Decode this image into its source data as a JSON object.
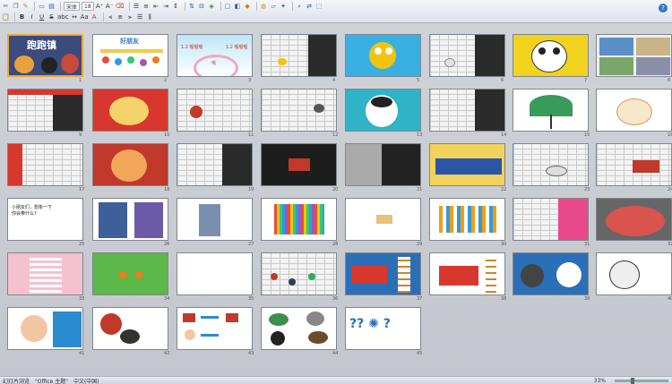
{
  "toolbar": {
    "font_name": "宋体",
    "font_size": "18",
    "bold": "B",
    "italic": "I",
    "underline": "U",
    "strike": "S",
    "shadow": "abc",
    "font_color": "A"
  },
  "slides": [
    {
      "n": "1"
    },
    {
      "n": "2"
    },
    {
      "n": "3"
    },
    {
      "n": "4"
    },
    {
      "n": "5"
    },
    {
      "n": "6"
    },
    {
      "n": "7"
    },
    {
      "n": "8"
    },
    {
      "n": "9"
    },
    {
      "n": "10"
    },
    {
      "n": "11"
    },
    {
      "n": "12"
    },
    {
      "n": "13"
    },
    {
      "n": "14"
    },
    {
      "n": "15"
    },
    {
      "n": "16"
    },
    {
      "n": "17"
    },
    {
      "n": "18"
    },
    {
      "n": "19"
    },
    {
      "n": "20"
    },
    {
      "n": "21"
    },
    {
      "n": "22"
    },
    {
      "n": "23"
    },
    {
      "n": "24"
    },
    {
      "n": "25"
    },
    {
      "n": "26"
    },
    {
      "n": "27"
    },
    {
      "n": "28"
    },
    {
      "n": "29"
    },
    {
      "n": "30"
    },
    {
      "n": "31"
    },
    {
      "n": "32"
    },
    {
      "n": "33"
    },
    {
      "n": "34"
    },
    {
      "n": "35"
    },
    {
      "n": "36"
    },
    {
      "n": "37"
    },
    {
      "n": "38"
    },
    {
      "n": "39"
    },
    {
      "n": "40"
    },
    {
      "n": "41"
    },
    {
      "n": "42"
    },
    {
      "n": "43"
    },
    {
      "n": "44"
    },
    {
      "n": "45"
    }
  ],
  "slide_text": {
    "s1_title": "跑跑镇",
    "s2_title": "好朋友",
    "s3_caption": "1.2 喔喔喔",
    "s3_caption2": "1.2 喔喔喔",
    "s3_word": "哦",
    "s25_text": "小朋友们，想象一下",
    "s25_text2": "你会带什么？"
  },
  "status": {
    "left1": "幻灯片浏览",
    "left2": "\"Office 主题\"",
    "left3": "中文(中国)",
    "zoom": "33%"
  },
  "colors": {
    "accent_selection": "#f0a63a"
  }
}
